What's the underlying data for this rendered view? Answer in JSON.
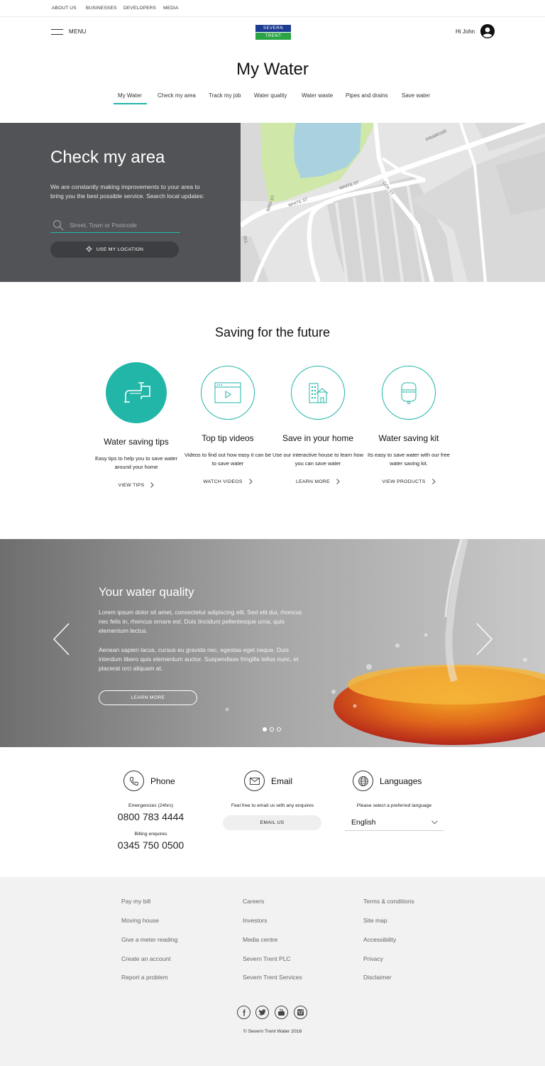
{
  "topnav": {
    "about": "ABOUT US",
    "businesses": "BUSINESSES",
    "developers": "DEVELOPERS",
    "media": "MEDIA"
  },
  "header": {
    "menu_label": "MENU",
    "logo_line1": "SEVERN",
    "logo_line2": "TRENT",
    "greeting": "Hi John",
    "page_title": "My Water"
  },
  "subnav": {
    "items": [
      "My Water",
      "Check my area",
      "Track my job",
      "Water quality",
      "Water waste",
      "Pipes and drains",
      "Save water"
    ],
    "active": "My Water"
  },
  "check_area": {
    "title": "Check my area",
    "description": "We are constantly making improvements to your area to bring you the best possible service. Search local updates:",
    "search_placeholder": "Street, Town or Postcode",
    "location_button": "USE MY LOCATION"
  },
  "map": {
    "labels": [
      "PRIMROSE",
      "WHITE ST",
      "WHITE ST",
      "COX ST",
      "BIRD ST",
      "ELL"
    ]
  },
  "saving": {
    "title": "Saving for the future",
    "cards": [
      {
        "icon": "tap-icon",
        "title": "Water saving tips",
        "desc": "Easy tips to help you to save water around your home",
        "link": "VIEW TIPS"
      },
      {
        "icon": "video-player-icon",
        "title": "Top tip videos",
        "desc": "Videos to find out how easy it can be to save water",
        "link": "WATCH VIDEOS"
      },
      {
        "icon": "house-icon",
        "title": "Save in your home",
        "desc": "Use our interactive house to learn how you can save water",
        "link": "LEARN MORE"
      },
      {
        "icon": "water-kit-icon",
        "title": "Water saving kit",
        "desc": "Its easy to save water with our free water saving kit.",
        "link": "VIEW PRODUCTS"
      }
    ]
  },
  "quality": {
    "title": "Your water quality",
    "p1": "Lorem ipsum dolor sit amet, consectetur adipiscing elit. Sed elit dui, rhoncus nec felis in, rhoncus ornare est. Duis tincidunt pellentesque urna, quis elementum lectus.",
    "p2": "Aenean sapien lacus, cursus eu gravida nec, egestas eget neque. Duis interdum libero quis elementum auctor. Suspendisse fringilla tellus nunc, et placerat orci aliquam at.",
    "button": "LEARN MORE",
    "slides_total": 3,
    "active_slide": 1
  },
  "contact": {
    "phone": {
      "label": "Phone",
      "emergency_label": "Emergencies (24hrs)",
      "emergency_number": "0800 783 4444",
      "billing_label": "Billing enquires",
      "billing_number": "0345 750 0500"
    },
    "email": {
      "label": "Email",
      "text": "Feel free to email us with any enquires",
      "button": "EMAIL US"
    },
    "languages": {
      "label": "Languages",
      "text": "Please select a preferred language",
      "selected": "English"
    }
  },
  "footer": {
    "col1": [
      "Pay my bill",
      "Moving house",
      "Give a meter reading",
      "Create an account",
      "Report a problem"
    ],
    "col2": [
      "Careers",
      "Investors",
      "Media centre",
      "Severn Trent PLC",
      "Severn Trent Services"
    ],
    "col3": [
      "Terms & conditions",
      "Site map",
      "Accessibility",
      "Privacy",
      "Disclaimer"
    ],
    "social": [
      "facebook-icon",
      "twitter-icon",
      "youtube-icon",
      "instagram-icon"
    ],
    "copyright": "© Severn Trent Water 2016"
  },
  "colors": {
    "accent": "#21b6a8",
    "panel": "#525356",
    "footer_bg": "#f2f2f2",
    "logo_blue": "#1b3c91",
    "logo_green": "#2aa446"
  }
}
